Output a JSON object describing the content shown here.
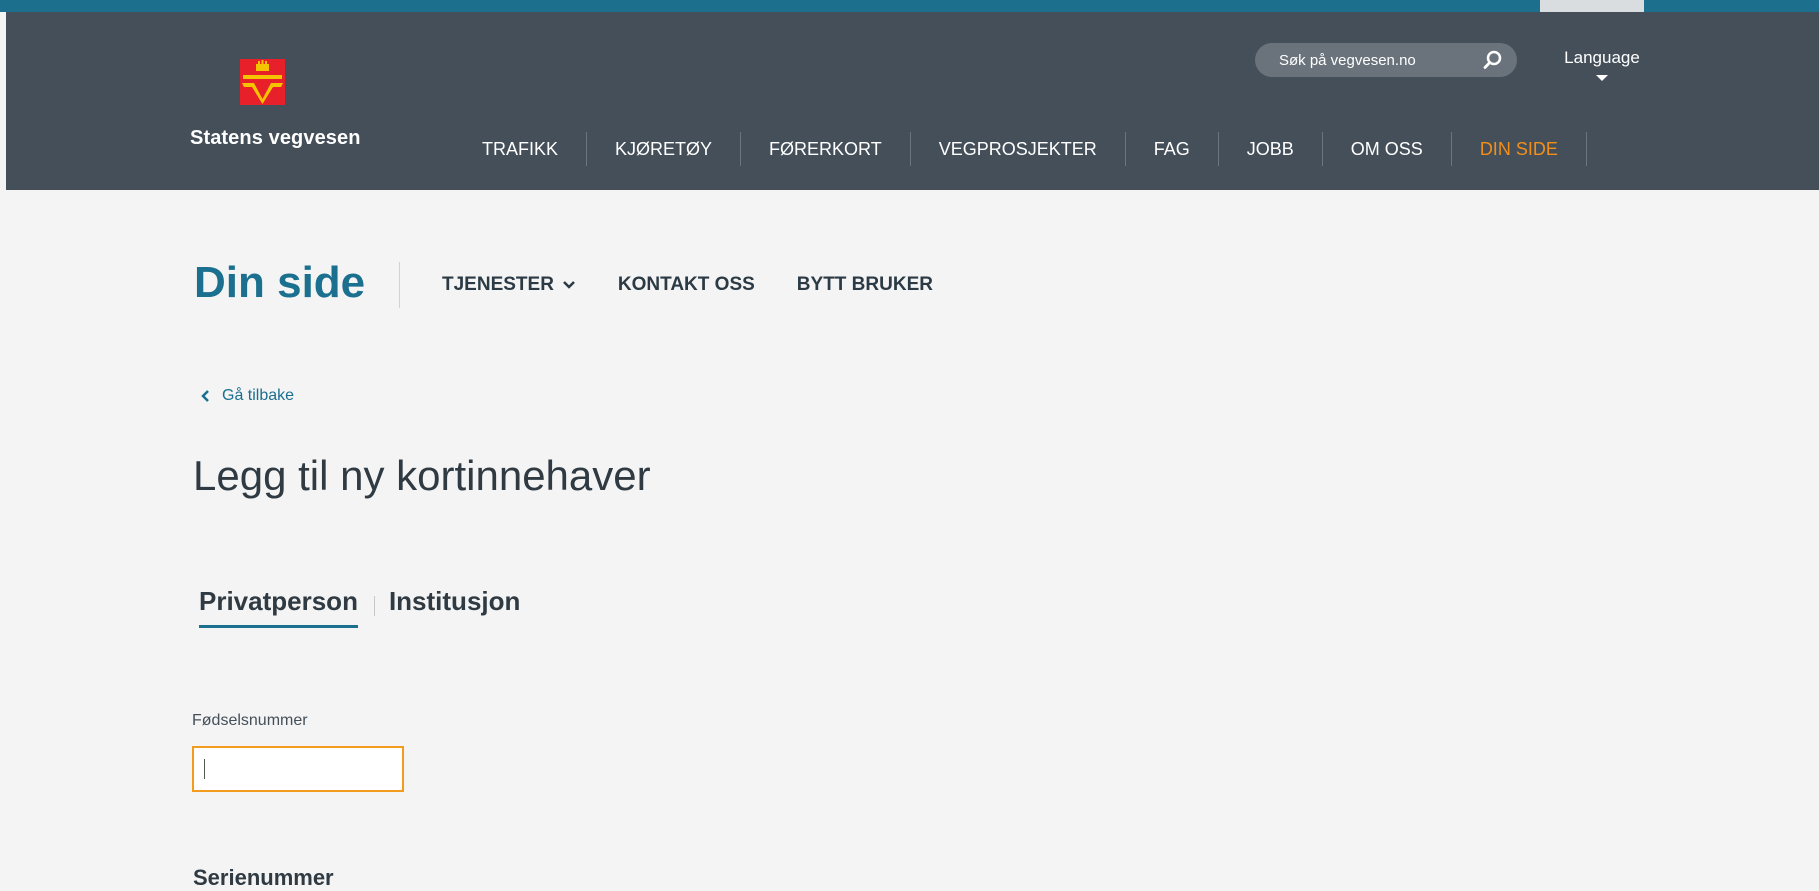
{
  "colors": {
    "header_bg": "#444f59",
    "accent_blue": "#1b6f8f",
    "active_orange": "#f28f1a",
    "logo_red": "#e8202a",
    "logo_yellow": "#f5c400",
    "page_bg": "#f4f4f4"
  },
  "header": {
    "logo_text": "Statens vegvesen",
    "logo_icon": "road-authority-emblem-icon",
    "search_placeholder": "Søk på vegvesen.no",
    "search_icon": "search-icon",
    "language_label": "Language",
    "nav": [
      {
        "label": "TRAFIKK",
        "active": false
      },
      {
        "label": "KJØRETØY",
        "active": false
      },
      {
        "label": "FØRERKORT",
        "active": false
      },
      {
        "label": "VEGPROSJEKTER",
        "active": false
      },
      {
        "label": "FAG",
        "active": false
      },
      {
        "label": "JOBB",
        "active": false
      },
      {
        "label": "OM OSS",
        "active": false
      },
      {
        "label": "DIN SIDE",
        "active": true
      }
    ]
  },
  "subnav": {
    "title": "Din side",
    "items": [
      {
        "label": "TJENESTER",
        "icon": "chevron-down-icon"
      },
      {
        "label": "KONTAKT OSS"
      },
      {
        "label": "BYTT BRUKER"
      }
    ]
  },
  "back_link": {
    "label": "Gå tilbake",
    "icon": "chevron-left-icon"
  },
  "page_title": "Legg til ny kortinnehaver",
  "tabs": [
    {
      "label": "Privatperson",
      "active": true
    },
    {
      "label": "Institusjon",
      "active": false
    }
  ],
  "form": {
    "birth_number_label": "Fødselsnummer",
    "birth_number_value": "",
    "serial_heading": "Serienummer"
  }
}
